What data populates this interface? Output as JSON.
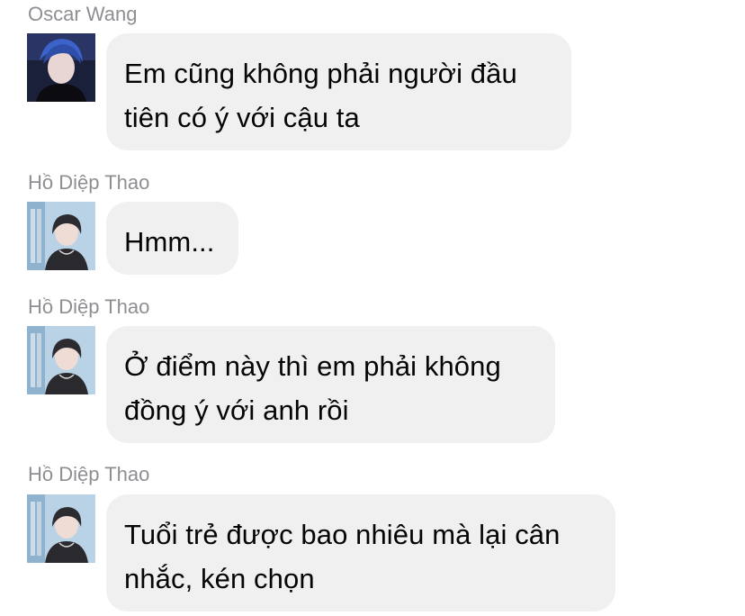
{
  "conversation": {
    "messages": [
      {
        "sender": "Oscar Wang",
        "avatar_icon": "oscar-wang-avatar",
        "lines": [
          "Em cũng không phải người đầu",
          "tiên có ý với cậu ta"
        ]
      },
      {
        "sender": "Hồ Diệp Thao",
        "avatar_icon": "ho-diep-thao-avatar",
        "lines": [
          "Hmm..."
        ]
      },
      {
        "sender": "Hồ Diệp Thao",
        "avatar_icon": "ho-diep-thao-avatar",
        "lines": [
          "Ở điểm này thì em phải không",
          "đồng ý với anh rồi"
        ]
      },
      {
        "sender": "Hồ Diệp Thao",
        "avatar_icon": "ho-diep-thao-avatar",
        "lines": [
          "Tuổi trẻ được bao nhiêu mà lại cân",
          "nhắc, kén chọn"
        ]
      }
    ]
  },
  "colors": {
    "bubble_background": "#f0f0f1",
    "sender_name": "#8e8e93",
    "message_text": "#050505"
  }
}
